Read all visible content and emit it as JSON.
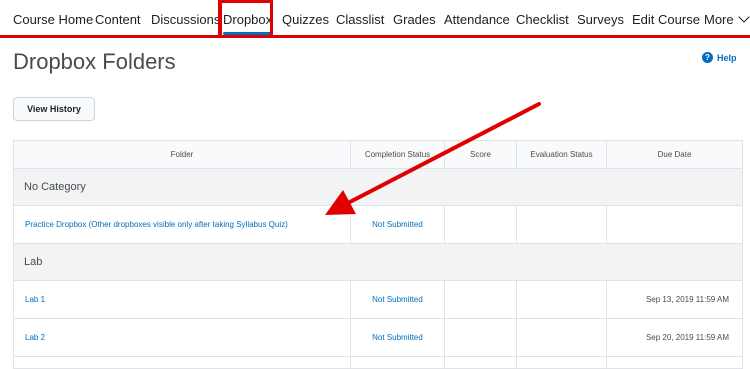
{
  "nav": {
    "items": [
      {
        "label": "Course Home"
      },
      {
        "label": "Content"
      },
      {
        "label": "Discussions"
      },
      {
        "label": "Dropbox"
      },
      {
        "label": "Quizzes"
      },
      {
        "label": "Classlist"
      },
      {
        "label": "Grades"
      },
      {
        "label": "Attendance"
      },
      {
        "label": "Checklist"
      },
      {
        "label": "Surveys"
      },
      {
        "label": "Edit Course"
      },
      {
        "label": "More"
      }
    ],
    "active": "Dropbox"
  },
  "page": {
    "title": "Dropbox Folders",
    "help_label": "Help",
    "view_history_label": "View History"
  },
  "table": {
    "headers": [
      "Folder",
      "Completion Status",
      "Score",
      "Evaluation Status",
      "Due Date"
    ],
    "groups": [
      {
        "category": "No Category",
        "rows": [
          {
            "folder": "Practice Dropbox (Other dropboxes visible only after taking Syllabus Quiz)",
            "completion": "Not Submitted",
            "score": "",
            "evaluation": "",
            "due": ""
          }
        ]
      },
      {
        "category": "Lab",
        "rows": [
          {
            "folder": "Lab 1",
            "completion": "Not Submitted",
            "score": "",
            "evaluation": "",
            "due": "Sep 13, 2019 11:59 AM"
          },
          {
            "folder": "Lab 2",
            "completion": "Not Submitted",
            "score": "",
            "evaluation": "",
            "due": "Sep 20, 2019 11:59 AM"
          }
        ]
      }
    ]
  },
  "colors": {
    "link": "#006fbf",
    "annotation": "#e00000",
    "text": "#494c4e"
  }
}
